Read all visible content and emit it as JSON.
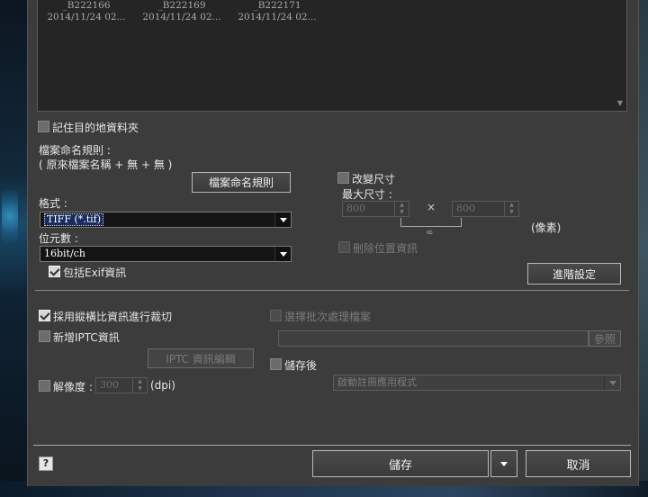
{
  "thumbnails": [
    {
      "name": "_B222166",
      "date": "2014/11/24 02..."
    },
    {
      "name": "_B222169",
      "date": "2014/11/24 02..."
    },
    {
      "name": "_B222171",
      "date": "2014/11/24 02..."
    }
  ],
  "remember_folder": {
    "label": "記住目的地資料夾",
    "checked": false
  },
  "naming": {
    "rule_label": "檔案命名規則 :",
    "rule_value": "( 原來檔案名稱 + 無 + 無 )",
    "button_label": "檔案命名規則"
  },
  "format": {
    "label": "格式 :",
    "value": "TIFF (*.tif)"
  },
  "bit_depth": {
    "label": "位元數 :",
    "value": "16bit/ch"
  },
  "include_exif": {
    "label": "包括Exif資訊",
    "checked": true
  },
  "resize": {
    "label": "改變尺寸",
    "max_size_label": "最大尺寸 :",
    "width": "800",
    "height": "800",
    "times": "×",
    "link_icon": "∞",
    "unit": "(像素)",
    "remove_location_label": "刪除位置資訊"
  },
  "advanced_button": "進階設定",
  "crop_aspect": {
    "label": "採用縱橫比資訊進行裁切",
    "checked": true
  },
  "add_iptc": {
    "label": "新增IPTC資訊",
    "checked": false
  },
  "iptc_edit_button": "IPTC 資訊編輯",
  "resolution": {
    "label": "解像度 :",
    "value": "300",
    "unit": "(dpi)"
  },
  "batch": {
    "label": "選擇批次處理檔案",
    "browse_button": "參照",
    "path": ""
  },
  "after_save": {
    "label": "儲存後",
    "app_placeholder": "啟動註冊應用程式"
  },
  "help": "?",
  "save_button": "儲存",
  "cancel_button": "取消"
}
